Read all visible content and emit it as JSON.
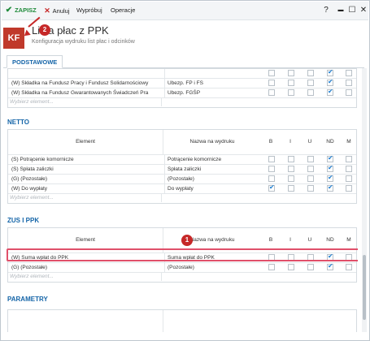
{
  "toolbar": {
    "save_label": "ZAPISZ",
    "cancel_label": "Anuluj",
    "print_label": "Wypróbuj",
    "operations_label": "Operacje",
    "help_label": "?",
    "minimize_label": "▬",
    "maximize_label": "☐",
    "close_label": "✕"
  },
  "header": {
    "badge": "KF",
    "title": "Lista płac z PPK",
    "subtitle": "Konfiguracja wydruku list płac i odcinków"
  },
  "tabs": [
    {
      "label": "PODSTAWOWE"
    }
  ],
  "columns": {
    "element": "Element",
    "print_name": "Nazwa na wydruku",
    "b": "B",
    "i": "I",
    "u": "U",
    "nd": "ND",
    "m": "M"
  },
  "add_placeholder": "Wybierz element...",
  "sections": {
    "basic": {
      "rows": [
        {
          "element": "",
          "name": "",
          "b": false,
          "i": false,
          "u": false,
          "nd": true,
          "m": false
        },
        {
          "element": "(W) Składka na Fundusz Pracy i Fundusz Solidarnościowy",
          "name": "Ubezp. FP i FS",
          "b": false,
          "i": false,
          "u": false,
          "nd": true,
          "m": false
        },
        {
          "element": "(W) Składka na Fundusz Gwarantowanych Świadczeń Pra",
          "name": "Ubezp. FGŚP",
          "b": false,
          "i": false,
          "u": false,
          "nd": true,
          "m": false
        }
      ]
    },
    "netto": {
      "title": "NETTO",
      "rows": [
        {
          "element": "(S) Potrącenie komornicze",
          "name": "Potrącenie komornicze",
          "b": false,
          "i": false,
          "u": false,
          "nd": true,
          "m": false
        },
        {
          "element": "(S) Spłata zaliczki",
          "name": "Spłata zaliczki",
          "b": false,
          "i": false,
          "u": false,
          "nd": true,
          "m": false
        },
        {
          "element": "(G) (Pozostałe)",
          "name": "(Pozostałe)",
          "b": false,
          "i": false,
          "u": false,
          "nd": true,
          "m": false
        },
        {
          "element": "(W) Do wypłaty",
          "name": "Do wypłaty",
          "b": true,
          "i": false,
          "u": false,
          "nd": true,
          "m": false
        }
      ]
    },
    "zus": {
      "title": "ZUS I PPK",
      "rows": [
        {
          "element": "(W) Suma wpłat do PPK",
          "name": "Suma wpłat do PPK",
          "b": false,
          "i": false,
          "u": false,
          "nd": true,
          "m": false
        },
        {
          "element": "(G) (Pozostałe)",
          "name": "(Pozostałe)",
          "b": false,
          "i": false,
          "u": false,
          "nd": true,
          "m": false
        }
      ]
    },
    "params": {
      "title": "PARAMETRY"
    }
  },
  "callouts": {
    "first": "1",
    "second": "2"
  },
  "colors": {
    "accent": "#1565a8",
    "save": "#1f8a3a",
    "cancel": "#c62828",
    "badge": "#c0392b",
    "check": "#1f7fd1",
    "highlight": "#e0506a"
  }
}
